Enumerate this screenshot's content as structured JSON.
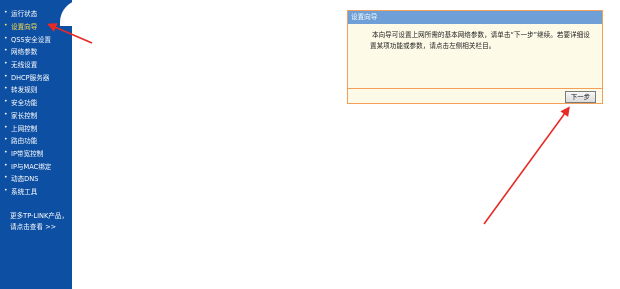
{
  "sidebar": {
    "items": [
      {
        "label": "运行状态"
      },
      {
        "label": "设置向导"
      },
      {
        "label": "QSS安全设置"
      },
      {
        "label": "网络参数"
      },
      {
        "label": "无线设置"
      },
      {
        "label": "DHCP服务器"
      },
      {
        "label": "转发规则"
      },
      {
        "label": "安全功能"
      },
      {
        "label": "家长控制"
      },
      {
        "label": "上网控制"
      },
      {
        "label": "路由功能"
      },
      {
        "label": "IP带宽控制"
      },
      {
        "label": "IP与MAC绑定"
      },
      {
        "label": "动态DNS"
      },
      {
        "label": "系统工具"
      }
    ],
    "active_index": 1,
    "more_line1": "更多TP-LINK产品，",
    "more_line2": "请点击查看 >>"
  },
  "wizard": {
    "title": "设置向导",
    "text": "本向导可设置上网所需的基本网络参数，请单击“下一步”继续。若要详细设置某项功能或参数，请点击左侧相关栏目。",
    "next_label": "下一步"
  },
  "colors": {
    "sidebar_bg": "#0d4fa3",
    "active_item": "#ffe24a",
    "panel_header": "#6e9fd6",
    "panel_border": "#f0a058",
    "arrow": "#e82a24"
  }
}
